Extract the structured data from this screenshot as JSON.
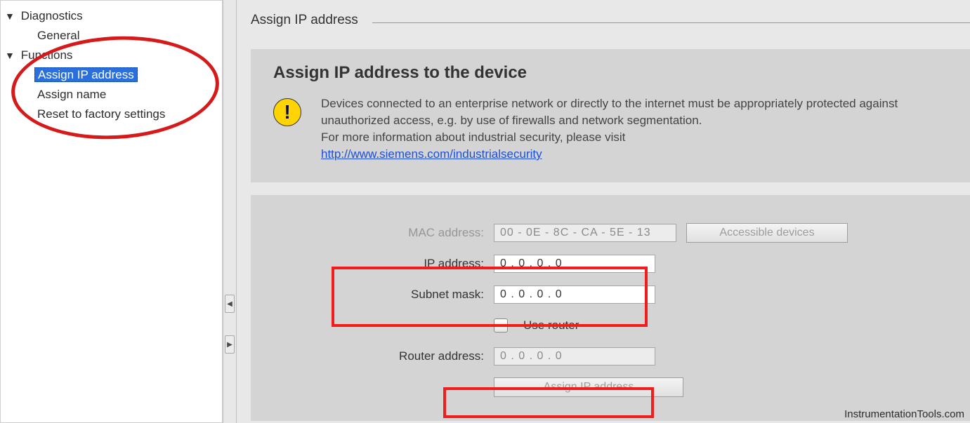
{
  "sidebar": {
    "nodes": [
      {
        "label": "Diagnostics",
        "expanded": true,
        "children": [
          {
            "label": "General"
          }
        ]
      },
      {
        "label": "Functions",
        "expanded": true,
        "children": [
          {
            "label": "Assign IP address",
            "selected": true
          },
          {
            "label": "Assign name"
          },
          {
            "label": "Reset to factory settings"
          }
        ]
      }
    ]
  },
  "page": {
    "title": "Assign IP address",
    "info_heading": "Assign IP address to the device",
    "info_text_1": "Devices connected to an enterprise network or directly to the internet must be appropriately protected against unauthorized access, e.g. by use of firewalls and network segmentation.",
    "info_text_2": "For more information about industrial security, please visit",
    "info_link": "http://www.siemens.com/industrialsecurity"
  },
  "form": {
    "mac_label": "MAC address:",
    "mac_value": "00  - 0E  - 8C  - CA  - 5E  - 13",
    "accessible_btn": "Accessible devices",
    "ip_label": "IP address:",
    "ip_value": "0      . 0      . 0      . 0",
    "subnet_label": "Subnet mask:",
    "subnet_value": "0      . 0      . 0      . 0",
    "use_router_label": "Use router",
    "router_label": "Router address:",
    "router_value": "0      . 0      . 0      . 0",
    "assign_btn": "Assign IP address"
  },
  "watermark": "InstrumentationTools.com"
}
